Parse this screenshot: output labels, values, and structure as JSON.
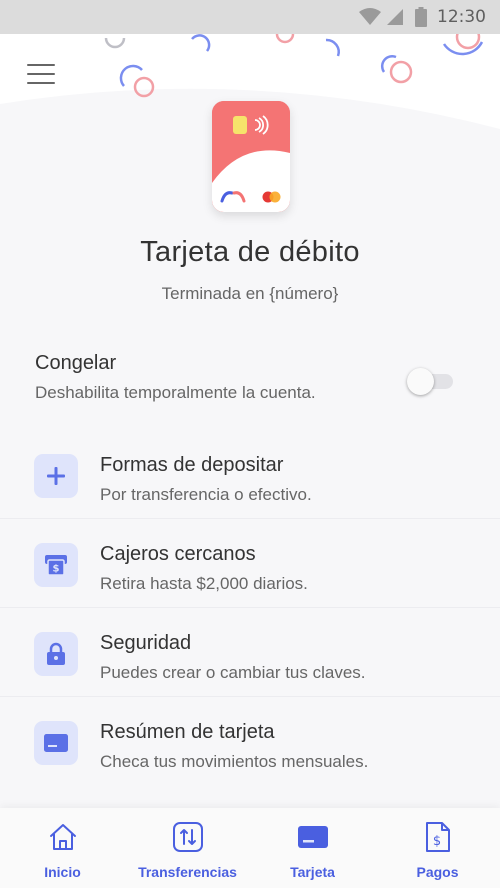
{
  "status_bar": {
    "time": "12:30"
  },
  "card": {
    "title": "Tarjeta de débito",
    "subtitle": "Terminada en {número}",
    "color": "#f47474"
  },
  "freeze": {
    "title": "Congelar",
    "description": "Deshabilita temporalmente la cuenta.",
    "enabled": false
  },
  "menu_items": [
    {
      "title": "Formas de depositar",
      "description": "Por transferencia o efectivo.",
      "icon": "plus-icon"
    },
    {
      "title": "Cajeros cercanos",
      "description": "Retira hasta $2,000 diarios.",
      "icon": "atm-icon"
    },
    {
      "title": "Seguridad",
      "description": "Puedes crear o cambiar tus claves.",
      "icon": "lock-icon"
    },
    {
      "title": "Resúmen de tarjeta",
      "description": "Checa tus movimientos mensuales.",
      "icon": "card-icon"
    }
  ],
  "bottom_nav": [
    {
      "label": "Inicio",
      "icon": "home-icon"
    },
    {
      "label": "Transferencias",
      "icon": "transfer-icon"
    },
    {
      "label": "Tarjeta",
      "icon": "card-icon",
      "active": true
    },
    {
      "label": "Pagos",
      "icon": "payment-document-icon"
    }
  ],
  "colors": {
    "accent": "#4a5fe0",
    "icon_background": "#dfe4fb",
    "confetti_blue": "#7b8ef0",
    "confetti_pink": "#f2a0a6"
  }
}
